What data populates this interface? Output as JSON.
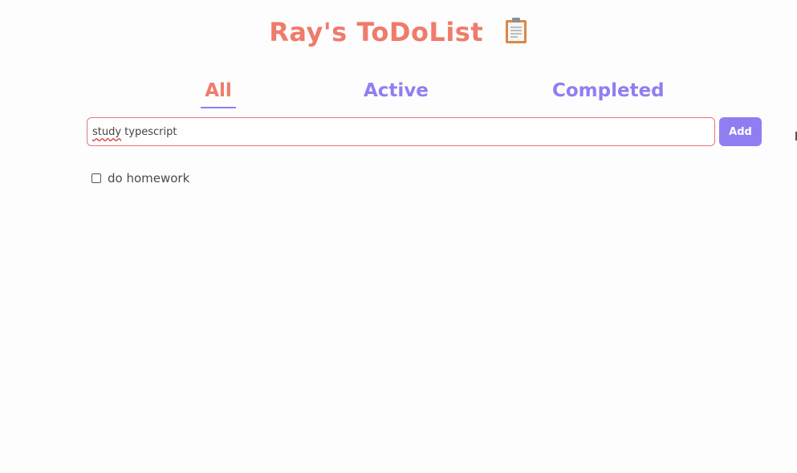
{
  "header": {
    "title": "Ray's ToDoList"
  },
  "icons": {
    "title_icon": "clipboard-icon"
  },
  "tabs": [
    {
      "label": "All",
      "selected": true
    },
    {
      "label": "Active",
      "selected": false
    },
    {
      "label": "Completed",
      "selected": false
    }
  ],
  "input": {
    "value": "study typescript",
    "misspelled_word": "study"
  },
  "add_button": {
    "label": "Add"
  },
  "todos": [
    {
      "label": "do homework",
      "checked": false
    }
  ],
  "colors": {
    "accent_coral": "#f07b6b",
    "accent_purple": "#8f7ef2",
    "input_border": "#e8767a"
  }
}
